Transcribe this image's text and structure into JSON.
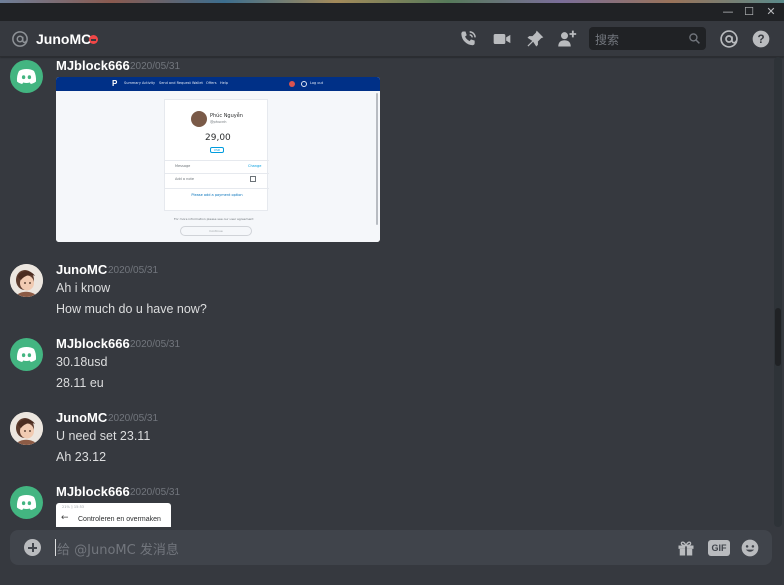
{
  "window": {
    "minimize_glyph": "—",
    "maximize_glyph": "☐",
    "close_glyph": "✕"
  },
  "header": {
    "channel_name": "JunoMC",
    "search_placeholder": "搜索",
    "icons": [
      "at-icon",
      "voice-call-icon",
      "video-call-icon",
      "pin-icon",
      "add-friend-icon",
      "search-icon",
      "mention-icon",
      "help-icon"
    ],
    "status_color": "#f04747"
  },
  "messages": [
    {
      "author": "MJblock666",
      "timestamp": "2020/05/31",
      "avatar": "discord-logo",
      "attachment": {
        "type": "screenshot",
        "content": {
          "nav_items": [
            "Summary",
            "Activity",
            "Send and Request",
            "Wallet",
            "Offers",
            "Help"
          ],
          "logout": "Log out",
          "name": "Phúc Nguyễn",
          "handle": "@phucnh",
          "amount": "29,00",
          "currency": "USD",
          "message_label": "Message",
          "change_label": "Change",
          "note_label": "Add a note",
          "payment_link": "Please add a payment option",
          "footer_note": "For more information please see our user agreement",
          "continue_button": "Continue"
        }
      }
    },
    {
      "author": "JunoMC",
      "timestamp": "2020/05/31",
      "avatar": "user-photo",
      "lines": [
        "Ah i know",
        "How much do u have now?"
      ]
    },
    {
      "author": "MJblock666",
      "timestamp": "2020/05/31",
      "avatar": "discord-logo",
      "lines": [
        "30.18usd",
        "28.11 eu"
      ]
    },
    {
      "author": "JunoMC",
      "timestamp": "2020/05/31",
      "avatar": "user-photo",
      "lines": [
        "U need set 23.11",
        "Ah 23.12"
      ]
    },
    {
      "author": "MJblock666",
      "timestamp": "2020/05/31",
      "avatar": "discord-logo",
      "attachment": {
        "type": "screenshot",
        "content": {
          "status_bar": "21% ▯ 15:53",
          "back_arrow": "←",
          "title": "Controleren en overmaken"
        }
      }
    }
  ],
  "composer": {
    "placeholder": "给 @JunoMC 发消息",
    "gif_label": "GIF",
    "icons": [
      "upload-plus-icon",
      "gift-icon",
      "gif-icon",
      "emoji-icon"
    ]
  },
  "colors": {
    "background": "#36393f",
    "discord_green": "#43b581",
    "paypal_blue": "#003087"
  }
}
